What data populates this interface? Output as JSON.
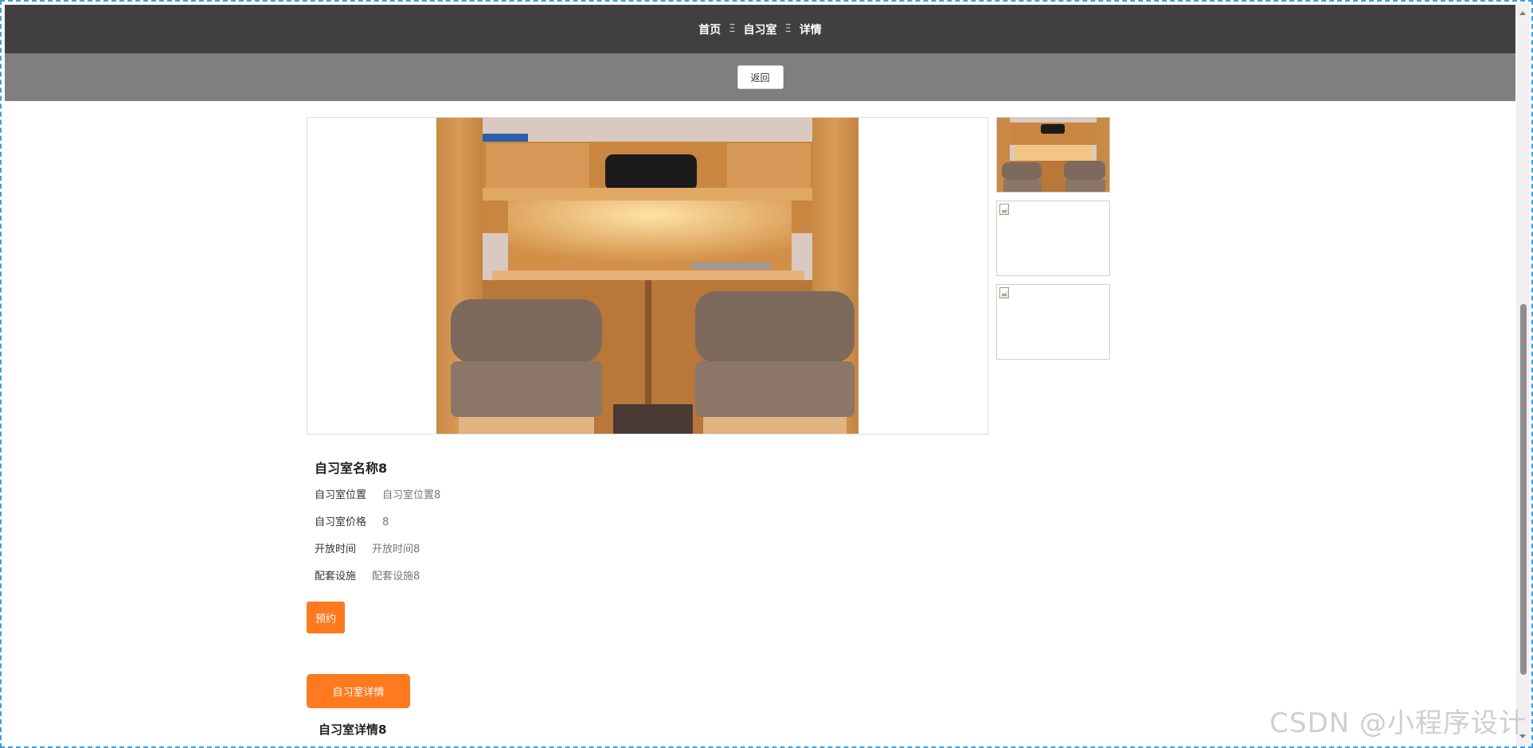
{
  "breadcrumb": {
    "home": "首页",
    "section": "自习室",
    "current": "详情",
    "separator": "Ξ"
  },
  "toolbar": {
    "back_label": "返回"
  },
  "room": {
    "title": "自习室名称8",
    "fields": [
      {
        "label": "自习室位置",
        "value": "自习室位置8"
      },
      {
        "label": "自习室价格",
        "value": "8"
      },
      {
        "label": "开放时间",
        "value": "开放时间8"
      },
      {
        "label": "配套设施",
        "value": "配套设施8"
      }
    ]
  },
  "actions": {
    "reserve_label": "预约"
  },
  "details": {
    "tab_label": "自习室详情",
    "content": "自习室详情8"
  },
  "watermark": "CSDN @小程序设计",
  "colors": {
    "header_bg": "#404040",
    "subbar_bg": "#7f7f7f",
    "accent": "#ff7a1f"
  }
}
